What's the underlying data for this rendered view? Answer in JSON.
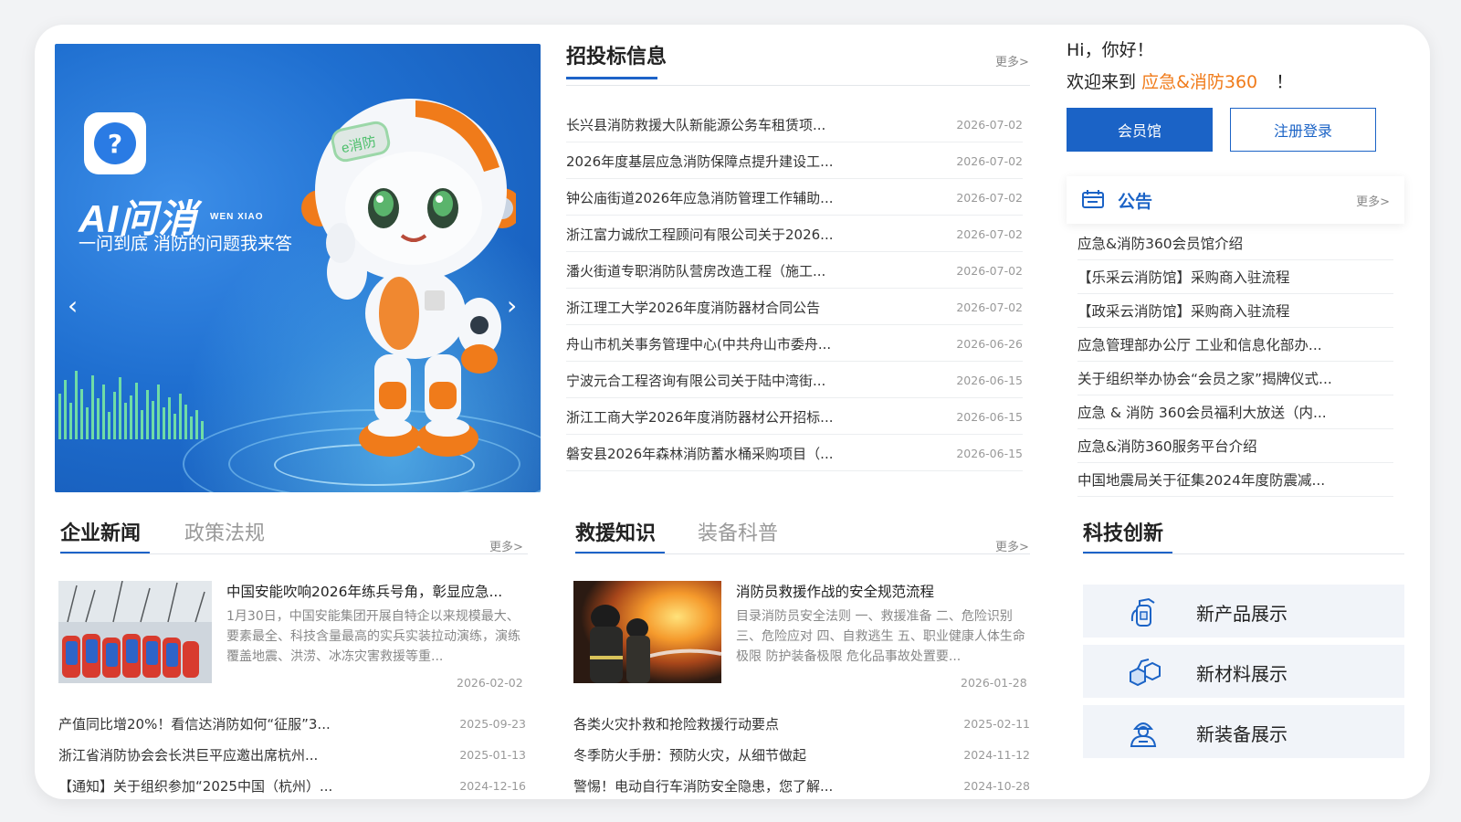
{
  "banner": {
    "title": "AI问消",
    "title_en": "WEN XIAO",
    "slogan": "一问到底 消防的问题我来答",
    "badge": "e消防",
    "logo_glyph": "?",
    "prev_icon": "chevron-left-icon",
    "next_icon": "chevron-right-icon"
  },
  "bidding": {
    "title": "招投标信息",
    "more": "更多>",
    "items": [
      {
        "title": "长兴县消防救援大队新能源公务车租赁项...",
        "date": "2026-07-02"
      },
      {
        "title": "2026年度基层应急消防保障点提升建设工...",
        "date": "2026-07-02"
      },
      {
        "title": "钟公庙街道2026年应急消防管理工作辅助...",
        "date": "2026-07-02"
      },
      {
        "title": "浙江富力诚欣工程顾问有限公司关于2026...",
        "date": "2026-07-02"
      },
      {
        "title": "潘火街道专职消防队营房改造工程（施工...",
        "date": "2026-07-02"
      },
      {
        "title": "浙江理工大学2026年度消防器材合同公告",
        "date": "2026-07-02"
      },
      {
        "title": "舟山市机关事务管理中心(中共舟山市委舟...",
        "date": "2026-06-26"
      },
      {
        "title": "宁波元合工程咨询有限公司关于陆中湾街...",
        "date": "2026-06-15"
      },
      {
        "title": "浙江工商大学2026年度消防器材公开招标...",
        "date": "2026-06-15"
      },
      {
        "title": "磐安县2026年森林消防蓄水桶采购项目（...",
        "date": "2026-06-15"
      }
    ]
  },
  "user": {
    "greeting": "Hi，你好！",
    "welcome_prefix": "欢迎来到",
    "brand": "应急&消防360",
    "welcome_suffix": "！",
    "member_button": "会员馆",
    "login_button": "注册登录"
  },
  "notice": {
    "title": "公告",
    "more": "更多>",
    "items": [
      "应急&消防360会员馆介绍",
      "【乐采云消防馆】采购商入驻流程",
      "【政采云消防馆】采购商入驻流程",
      "应急管理部办公厅 工业和信息化部办...",
      "关于组织举办协会“会员之家”揭牌仪式...",
      "应急 & 消防 360会员福利大放送（内...",
      "应急&消防360服务平台介绍",
      "中国地震局关于征集2024年度防震减..."
    ]
  },
  "news": {
    "tab_active": "企业新闻",
    "tab_inactive": "政策法规",
    "more": "更多>",
    "featured": {
      "title": "中国安能吹响2026年练兵号角，彰显应急...",
      "body": "1月30日，中国安能集团开展自特企以来规模最大、要素最全、科技含量最高的实兵实装拉动演练，演练覆盖地震、洪涝、冰冻灾害救援等重...",
      "date": "2026-02-02"
    },
    "items": [
      {
        "title": "产值同比增20%！看信达消防如何“征服”3...",
        "date": "2025-09-23"
      },
      {
        "title": "浙江省消防协会会长洪巨平应邀出席杭州...",
        "date": "2025-01-13"
      },
      {
        "title": "【通知】关于组织参加“2025中国（杭州）...",
        "date": "2024-12-16"
      }
    ]
  },
  "rescue": {
    "tab_active": "救援知识",
    "tab_inactive": "装备科普",
    "more": "更多>",
    "featured": {
      "title": "消防员救援作战的安全规范流程",
      "body": "目录消防员安全法则 一、救援准备 二、危险识别三、危险应对 四、自救逃生 五、职业健康人体生命极限 防护装备极限 危化品事故处置要...",
      "date": "2026-01-28"
    },
    "items": [
      {
        "title": "各类火灾扑救和抢险救援行动要点",
        "date": "2025-02-11"
      },
      {
        "title": "冬季防火手册：预防火灾，从细节做起",
        "date": "2024-11-12"
      },
      {
        "title": "警惕！电动自行车消防安全隐患，您了解...",
        "date": "2024-10-28"
      }
    ]
  },
  "tech": {
    "title": "科技创新",
    "items": [
      {
        "label": "新产品展示",
        "icon": "fire-extinguisher-icon"
      },
      {
        "label": "新材料展示",
        "icon": "cubes-icon"
      },
      {
        "label": "新装备展示",
        "icon": "firefighter-icon"
      }
    ]
  },
  "colors": {
    "primary": "#1b63c6",
    "brand_orange": "#f07b1a",
    "muted": "#999999"
  }
}
